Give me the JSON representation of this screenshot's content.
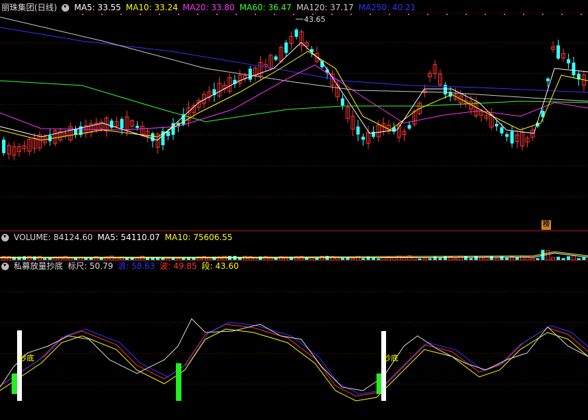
{
  "main_panel": {
    "stock_name": "丽珠集团(日线)",
    "ma_items": [
      {
        "label": "MA5: 33.55",
        "color": "#ffffff"
      },
      {
        "label": "MA10: 33.24",
        "color": "#ffff00"
      },
      {
        "label": "MA20: 33.80",
        "color": "#ff33ff"
      },
      {
        "label": "MA60: 36.47",
        "color": "#33ff33"
      },
      {
        "label": "MA120: 37.17",
        "color": "#cccccc"
      },
      {
        "label": "MA250: 40.21",
        "color": "#3333ff"
      }
    ],
    "high_marker": "43.65",
    "badge": "榜"
  },
  "volume_panel": {
    "title": "VOLUME: 84124.60",
    "ma5": "MA5: 54110.07",
    "ma10": "MA10: 75606.55",
    "colors": {
      "title": "#dddddd",
      "ma5": "#ffffff",
      "ma10": "#ffff00"
    }
  },
  "indicator_panel": {
    "title": "私募放量抄底",
    "items": [
      {
        "label": "标尺: 50.79",
        "color": "#dddddd"
      },
      {
        "label": "浪: 58.63",
        "color": "#3333ff"
      },
      {
        "label": "波: 49.85",
        "color": "#ff3333"
      },
      {
        "label": "段: 43.60",
        "color": "#ffff00"
      }
    ],
    "signal_label": "抄底",
    "signal_color": "#ffff00"
  },
  "colors": {
    "up": "#ff3333",
    "down": "#33ffff",
    "grid": "#8a1010",
    "border": "#b0161e"
  }
}
